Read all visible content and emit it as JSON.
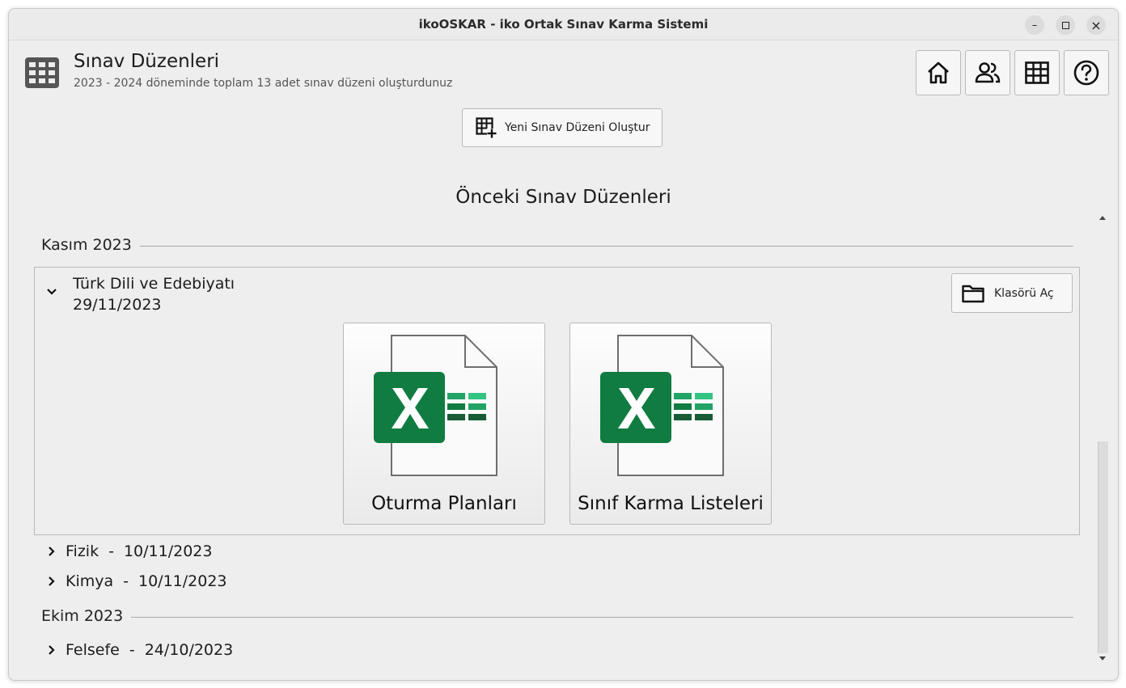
{
  "window": {
    "title": "ikoOSKAR - iko Ortak Sınav Karma Sistemi",
    "controls": {
      "minimize": "–",
      "maximize": "▫",
      "close": "×"
    }
  },
  "header": {
    "title": "Sınav Düzenleri",
    "subtitle": "2023 - 2024 döneminde toplam 13 adet sınav düzeni oluşturdunuz",
    "icon": "table-icon",
    "nav_buttons": [
      "home-icon",
      "people-icon",
      "table-icon",
      "help-icon"
    ]
  },
  "new_button": {
    "label": "Yeni Sınav Düzeni Oluştur",
    "icon": "table-add-icon"
  },
  "section_title": "Önceki Sınav Düzenleri",
  "groups": [
    {
      "month": "Kasım 2023",
      "expanded_item": {
        "title": "Türk Dili ve Edebiyatı",
        "date": "29/11/2023",
        "folder_button": "Klasörü Aç",
        "cards": [
          {
            "label": "Oturma Planları",
            "icon": "excel-icon"
          },
          {
            "label": "Sınıf Karma Listeleri",
            "icon": "excel-icon"
          }
        ]
      },
      "items": [
        {
          "subject": "Fizik",
          "separator": "-",
          "date": "10/11/2023"
        },
        {
          "subject": "Kimya",
          "separator": "-",
          "date": "10/11/2023"
        }
      ]
    },
    {
      "month": "Ekim 2023",
      "items": [
        {
          "subject": "Felsefe",
          "separator": "-",
          "date": "24/10/2023"
        }
      ]
    }
  ],
  "colors": {
    "excel_green": "#107c41",
    "excel_light": "#33c481",
    "excel_dark": "#185c37"
  }
}
